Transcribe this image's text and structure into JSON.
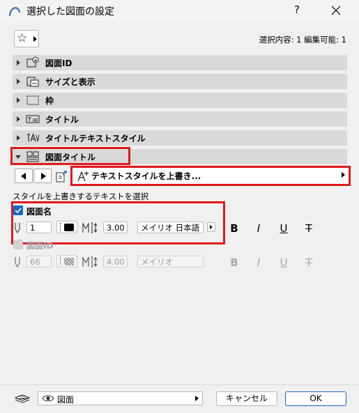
{
  "window": {
    "title": "選択した図面の設定",
    "help": "?"
  },
  "selection_info": "選択内容: 1 編集可能: 1",
  "sections": [
    {
      "label": "図面ID",
      "icon": "drawing-id-icon"
    },
    {
      "label": "サイズと表示",
      "icon": "size-display-icon"
    },
    {
      "label": "枠",
      "icon": "frame-icon"
    },
    {
      "label": "タイトル",
      "icon": "title-icon"
    },
    {
      "label": "タイトルテキストスタイル",
      "icon": "title-text-style-icon"
    },
    {
      "label": "図面タイトル",
      "icon": "drawing-title-icon"
    }
  ],
  "text_style": {
    "override_label": "テキストスタイルを上書き...",
    "select_caption": "スタイルを上書きするテキストを選択"
  },
  "rows": [
    {
      "label": "図面名",
      "checked": true,
      "pen": "1",
      "font_size": "3.00",
      "font": "メイリオ 日本語"
    },
    {
      "label": "図面ID",
      "checked": false,
      "pen": "66",
      "font_size": "4.00",
      "font": "メイリオ"
    }
  ],
  "format_buttons": [
    "B",
    "I",
    "U",
    "T"
  ],
  "footer": {
    "view": "図面",
    "cancel": "キャンセル",
    "ok": "OK"
  },
  "colors": {
    "accent": "#1667c6",
    "highlight": "#e0191f",
    "section_bg": "#d9d9d9"
  }
}
